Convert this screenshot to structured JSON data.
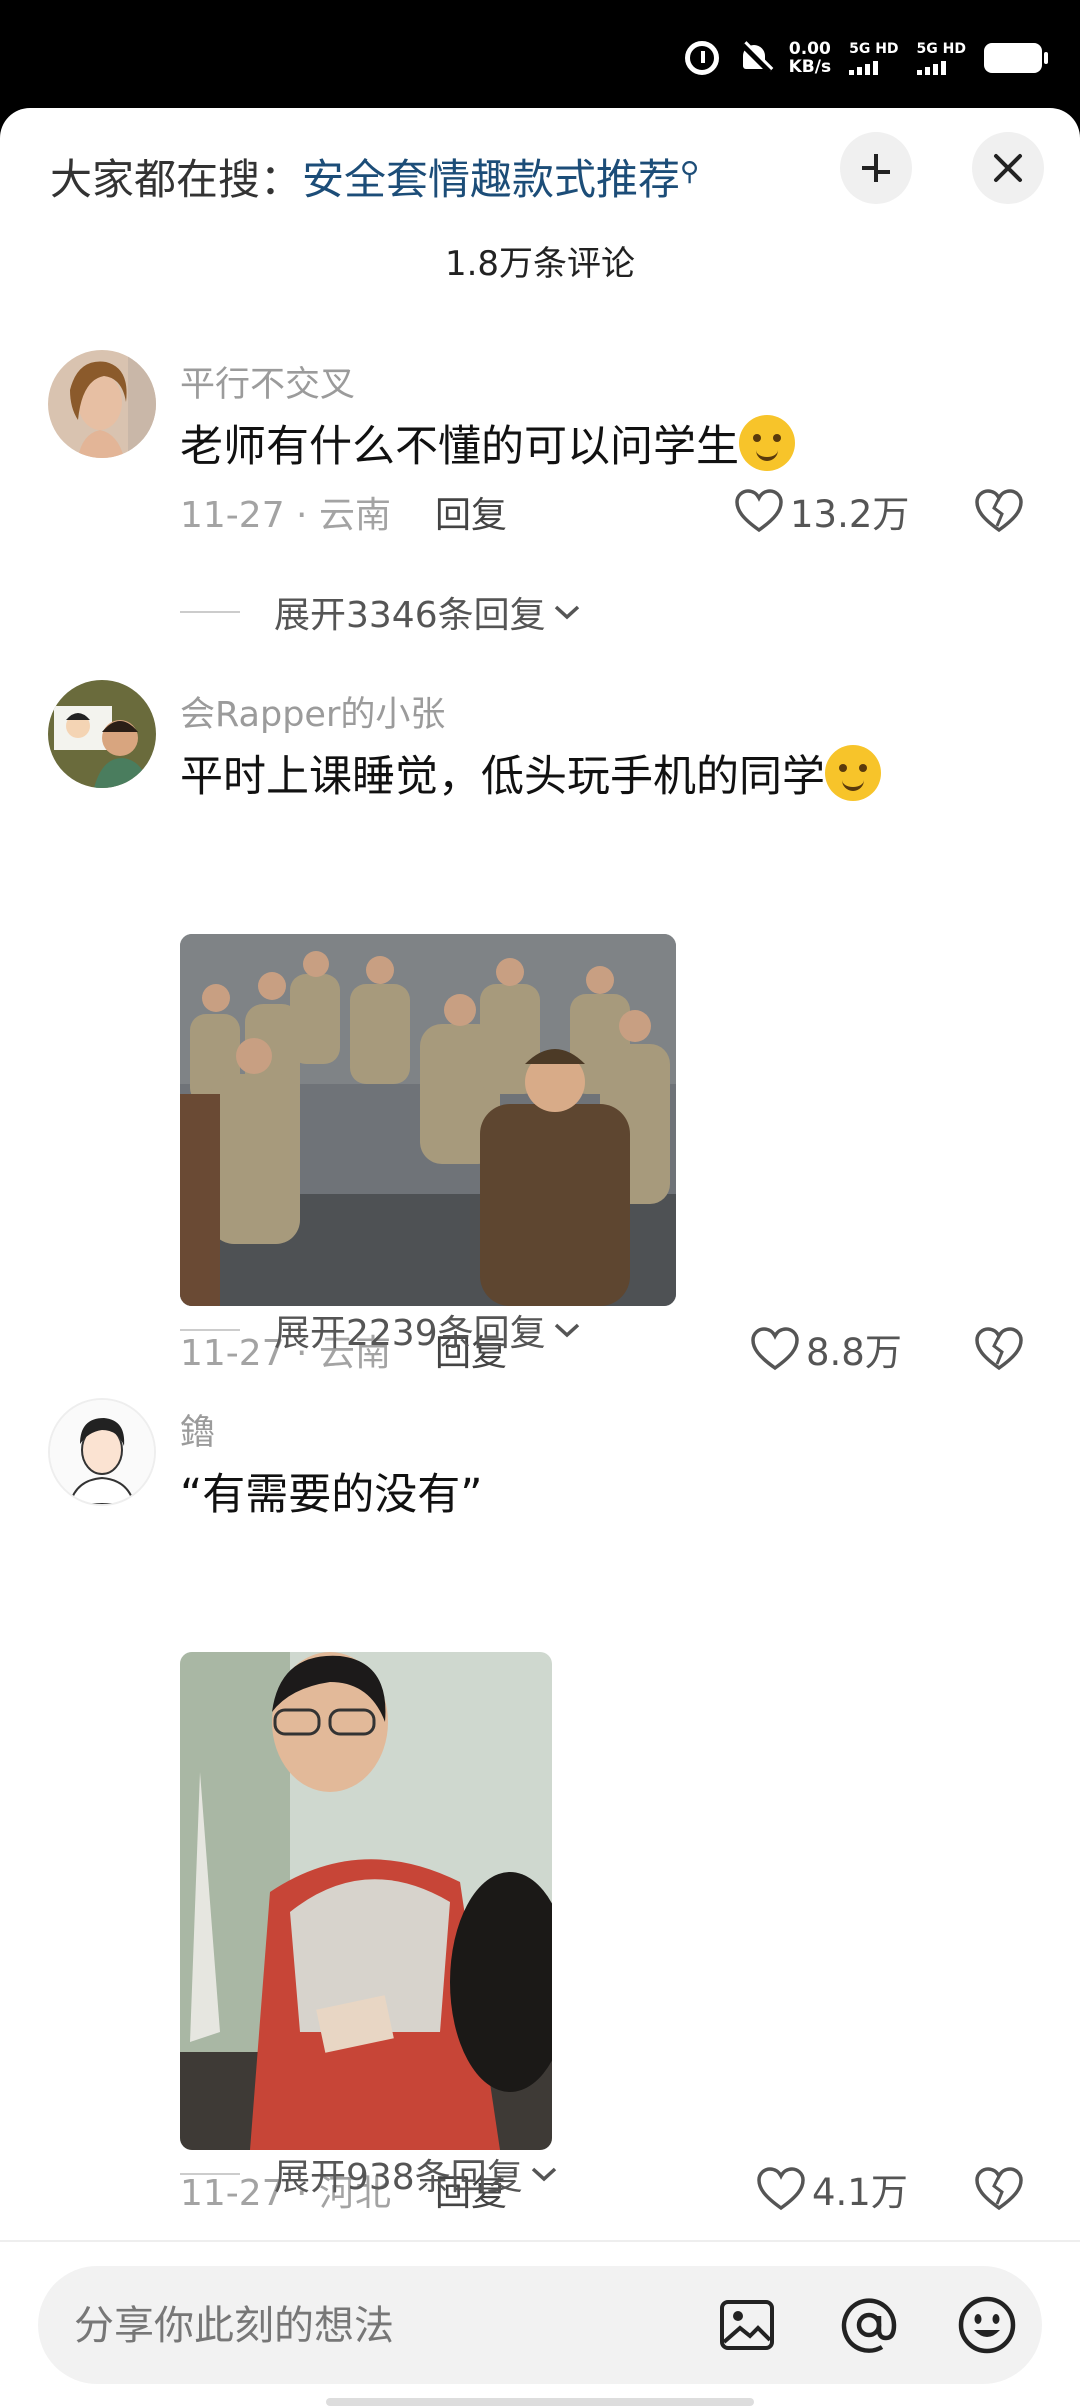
{
  "status_bar": {
    "speed_value": "0.00",
    "speed_unit": "KB/s",
    "net1": "5G HD",
    "net2": "5G HD"
  },
  "header": {
    "search_prefix": "大家都在搜：",
    "search_keyword": "安全套情趣款式推荐",
    "search_icon": "search-icon",
    "comment_count": "1.8万条评论"
  },
  "comments": [
    {
      "username": "平行不交叉",
      "text": "老师有什么不懂的可以问学生",
      "date": "11-27",
      "location": "云南",
      "reply_label": "回复",
      "likes": "13.2万",
      "expand_label": "展开3346条回复"
    },
    {
      "username": "会Rapper的小张",
      "text": "平时上课睡觉，低头玩手机的同学",
      "date": "11-27",
      "location": "云南",
      "reply_label": "回复",
      "likes": "8.8万",
      "expand_label": "展开2239条回复"
    },
    {
      "username": "鑥",
      "text": "“有需要的没有”",
      "date": "11-27",
      "location": "河北",
      "reply_label": "回复",
      "likes": "4.1万",
      "expand_label": "展开938条回复"
    }
  ],
  "input": {
    "placeholder": "分享你此刻的想法"
  },
  "colors": {
    "accent_link": "#1c4d78",
    "meta_gray": "#a3a3a3"
  }
}
